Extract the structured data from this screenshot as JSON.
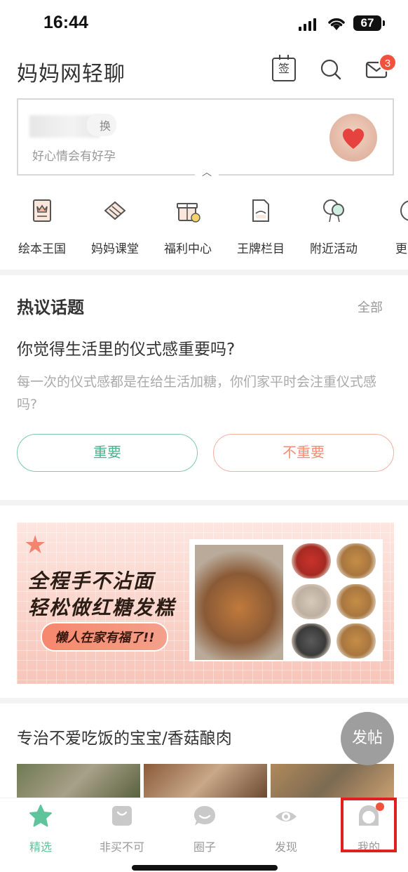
{
  "status": {
    "time": "16:44",
    "battery": "67"
  },
  "header": {
    "title": "妈妈网轻聊",
    "sign_label": "签",
    "msg_badge": "3"
  },
  "profile": {
    "switch_label": "换",
    "tagline": "好心情会有好孕",
    "collapse": "︿"
  },
  "nav": [
    {
      "label": "绘本王国",
      "icon": "picture-book-icon"
    },
    {
      "label": "妈妈课堂",
      "icon": "classroom-icon"
    },
    {
      "label": "福利中心",
      "icon": "gift-icon"
    },
    {
      "label": "王牌栏目",
      "icon": "column-icon"
    },
    {
      "label": "附近活动",
      "icon": "balloon-icon"
    },
    {
      "label": "更",
      "icon": "more-icon"
    }
  ],
  "topic": {
    "header": "热议话题",
    "all": "全部",
    "question": "你觉得生活里的仪式感重要吗?",
    "description": "每一次的仪式感都是在给生活加糖，你们家平时会注重仪式感吗?",
    "yes": "重要",
    "no": "不重要"
  },
  "banner": {
    "line1": "全程手不沾面",
    "line2": "轻松做红糖发糕",
    "pill": "懒人在家有福了!!"
  },
  "post": {
    "title": "专治不爱吃饭的宝宝/香菇酿肉"
  },
  "fab": "发帖",
  "tabs": [
    {
      "label": "精选",
      "icon": "star-icon",
      "active": true
    },
    {
      "label": "非买不可",
      "icon": "shopping-bag-icon"
    },
    {
      "label": "圈子",
      "icon": "chat-bubble-icon"
    },
    {
      "label": "发现",
      "icon": "eye-icon"
    },
    {
      "label": "我的",
      "icon": "profile-icon"
    }
  ],
  "colors": {
    "accent_green": "#5fc49b",
    "accent_orange": "#f08e75",
    "badge_red": "#f0523c"
  }
}
